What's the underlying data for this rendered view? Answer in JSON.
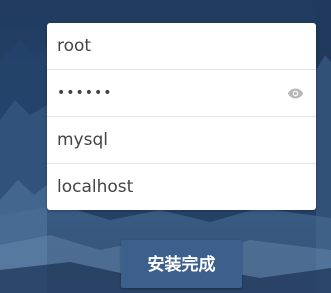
{
  "form": {
    "username_value": "root",
    "password_value": "••••••",
    "database_value": "mysql",
    "host_value": "localhost",
    "password_toggle_icon": "eye-icon"
  },
  "actions": {
    "install_label": "安装完成"
  },
  "colors": {
    "background": "#1c3557",
    "button": "#3d5f8c",
    "card": "#ffffff"
  }
}
